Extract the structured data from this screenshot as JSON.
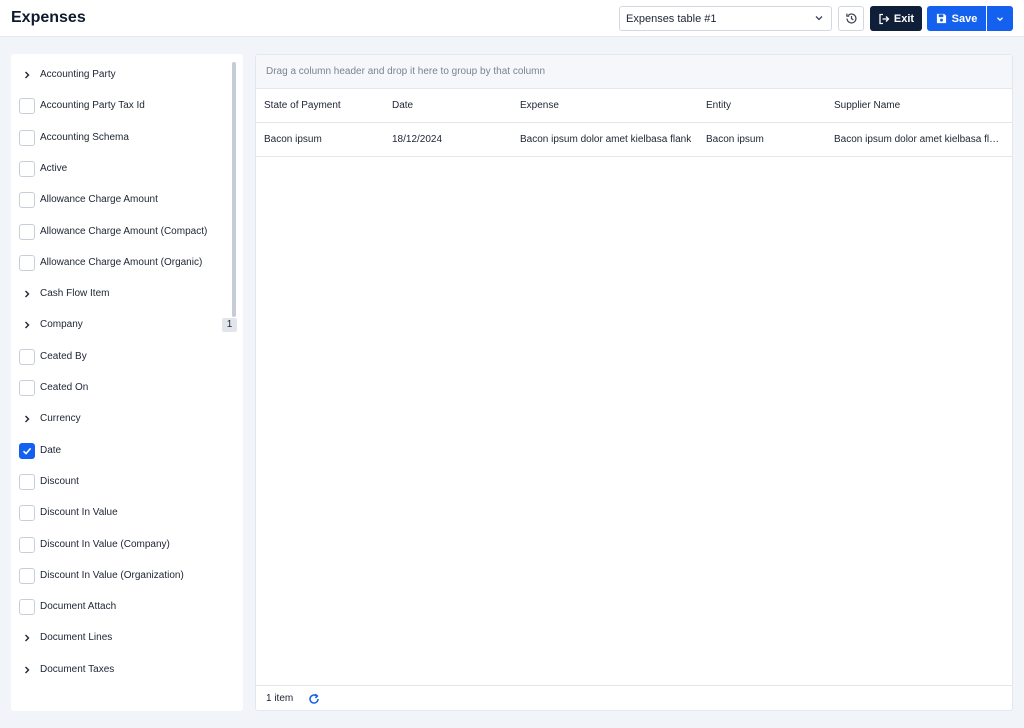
{
  "header": {
    "title": "Expenses",
    "view_selected": "Expenses table #1",
    "exit_label": "Exit",
    "save_label": "Save"
  },
  "sidebar": {
    "items": [
      {
        "label": "Accounting Party",
        "kind": "group"
      },
      {
        "label": "Accounting Party Tax Id",
        "kind": "field",
        "checked": false
      },
      {
        "label": "Accounting Schema",
        "kind": "field",
        "checked": false
      },
      {
        "label": "Active",
        "kind": "field",
        "checked": false
      },
      {
        "label": "Allowance Charge Amount",
        "kind": "field",
        "checked": false
      },
      {
        "label": "Allowance Charge Amount (Compact)",
        "kind": "field",
        "checked": false
      },
      {
        "label": "Allowance Charge Amount (Organic)",
        "kind": "field",
        "checked": false
      },
      {
        "label": "Cash Flow Item",
        "kind": "group"
      },
      {
        "label": "Company",
        "kind": "group",
        "count": "1"
      },
      {
        "label": "Ceated By",
        "kind": "field",
        "checked": false
      },
      {
        "label": "Ceated On",
        "kind": "field",
        "checked": false
      },
      {
        "label": "Currency",
        "kind": "group"
      },
      {
        "label": "Date",
        "kind": "field",
        "checked": true
      },
      {
        "label": "Discount",
        "kind": "field",
        "checked": false
      },
      {
        "label": "Discount In Value",
        "kind": "field",
        "checked": false
      },
      {
        "label": "Discount In Value (Company)",
        "kind": "field",
        "checked": false
      },
      {
        "label": "Discount In Value (Organization)",
        "kind": "field",
        "checked": false
      },
      {
        "label": "Document Attach",
        "kind": "field",
        "checked": false
      },
      {
        "label": "Document Lines",
        "kind": "group"
      },
      {
        "label": "Document Taxes",
        "kind": "group"
      }
    ]
  },
  "grid": {
    "group_hint": "Drag a column header and drop it here to group by that column",
    "columns": [
      "State of Payment",
      "Date",
      "Expense",
      "Entity",
      "Supplier Name"
    ],
    "rows": [
      [
        "Bacon ipsum",
        "18/12/2024",
        "Bacon ipsum dolor amet kielbasa flank",
        "Bacon ipsum",
        "Bacon ipsum dolor amet kielbasa flank"
      ]
    ],
    "footer_count": "1 item"
  },
  "colors": {
    "primary": "#1361ee",
    "dark": "#0f1f3a",
    "background": "#f1f4f9"
  },
  "icons": {
    "history": "history-icon",
    "exit": "exit-icon",
    "save": "save-icon",
    "refresh": "refresh-icon"
  }
}
